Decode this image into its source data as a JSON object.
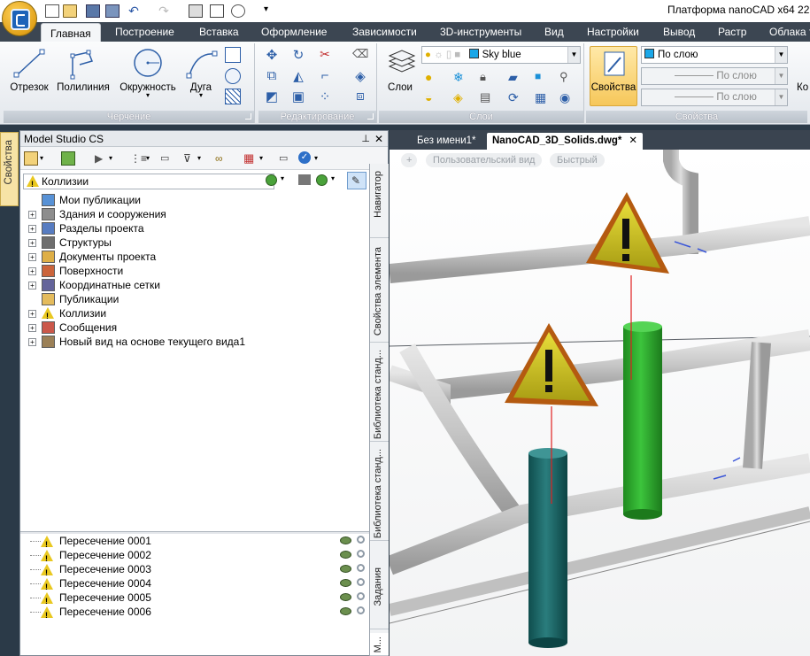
{
  "window": {
    "title": "Платформа nanoCAD x64 22 -"
  },
  "quick_access": {
    "icons": [
      "new-document-icon",
      "open-folder-icon",
      "save-icon",
      "save-as-icon",
      "undo-icon",
      "redo-icon",
      "print-icon",
      "measure-icon",
      "link-icon"
    ],
    "more": "▾"
  },
  "ribbon_tabs": [
    "Главная",
    "Построение",
    "Вставка",
    "Оформление",
    "Зависимости",
    "3D-инструменты",
    "Вид",
    "Настройки",
    "Вывод",
    "Растр",
    "Облака т"
  ],
  "ribbon": {
    "drawing": {
      "label": "Черчение",
      "buttons": [
        "Отрезок",
        "Полилиния",
        "Окружность",
        "Дуга"
      ]
    },
    "editing": {
      "label": "Редактирование"
    },
    "layers": {
      "label": "Слои",
      "button": "Слои",
      "layer_combo": "Sky blue",
      "layer_color": "#1aa7e8"
    },
    "properties": {
      "label": "Свойства",
      "button": "Свойства",
      "color_combo": "По слою",
      "linetype_combo": "По слою",
      "lineweight_combo": "По слою",
      "next_group": "Ко"
    }
  },
  "side_tab": "Свойства",
  "panel": {
    "title": "Model Studio CS",
    "pin": "⊥",
    "close": "✕",
    "collision_select": "Коллизии",
    "tree": [
      {
        "label": "Мои публикации",
        "expandable": false,
        "icon": "publications-icon",
        "color": "#3c7fcf"
      },
      {
        "label": "Здания и сооружения",
        "expandable": true,
        "icon": "building-icon",
        "color": "#7a7a7a"
      },
      {
        "label": "Разделы проекта",
        "expandable": true,
        "icon": "sections-icon",
        "color": "#3a66b7"
      },
      {
        "label": "Структуры",
        "expandable": true,
        "icon": "structure-icon",
        "color": "#555555"
      },
      {
        "label": "Документы проекта",
        "expandable": true,
        "icon": "documents-icon",
        "color": "#d9a227"
      },
      {
        "label": "Поверхности",
        "expandable": true,
        "icon": "surfaces-icon",
        "color": "#c24a1a"
      },
      {
        "label": "Координатные сетки",
        "expandable": true,
        "icon": "grid-icon",
        "color": "#4a4a8a"
      },
      {
        "label": "Публикации",
        "expandable": false,
        "icon": "publication-icon",
        "color": "#e0b040"
      },
      {
        "label": "Коллизии",
        "expandable": true,
        "icon": "warning-icon",
        "color": "#e9c820"
      },
      {
        "label": "Сообщения",
        "expandable": true,
        "icon": "messages-icon",
        "color": "#c23b2b"
      },
      {
        "label": "Новый вид на основе текущего вида1",
        "expandable": true,
        "icon": "view-icon",
        "color": "#8a6a3a"
      }
    ],
    "intersections": [
      "Пересечение 0001",
      "Пересечение 0002",
      "Пересечение 0003",
      "Пересечение 0004",
      "Пересечение 0005",
      "Пересечение 0006"
    ]
  },
  "vertical_tabs": [
    "Навигатор",
    "Свойства элемента",
    "Библиотека станд...",
    "Библиотека станд...",
    "Задания",
    "М..."
  ],
  "document_tabs": [
    {
      "label": "Без имени1*",
      "active": false
    },
    {
      "label": "NanoCAD_3D_Solids.dwg*",
      "active": true,
      "close": "✕"
    }
  ],
  "viewport_bar": {
    "plus": "+",
    "view": "Пользовательский вид",
    "style": "Быстрый"
  },
  "scene_colors": {
    "pipe": "#c8c8c8",
    "green_column": "#2fa82f",
    "teal_column": "#1d6a6a",
    "warning": "#d6c500",
    "warning_border": "#b45a10"
  }
}
